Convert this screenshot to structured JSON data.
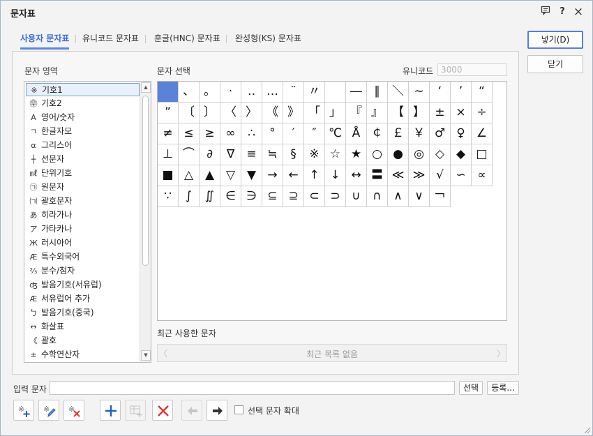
{
  "window": {
    "title": "문자표"
  },
  "titlebar": {
    "buttons": [
      "comment-icon",
      "help-icon",
      "close-icon"
    ],
    "help_glyph": "?",
    "close_glyph": "×",
    "comment_glyph": "▤"
  },
  "tabs": [
    {
      "label": "사용자 문자표",
      "active": true
    },
    {
      "label": "유니코드 문자표",
      "active": false
    },
    {
      "label": "훈글(HNC) 문자표",
      "active": false
    },
    {
      "label": "완성형(KS) 문자표",
      "active": false
    }
  ],
  "area": {
    "label": "문자 영역",
    "items": [
      {
        "icon": "※",
        "label": "기호1"
      },
      {
        "icon": "㉾",
        "label": "기호2"
      },
      {
        "icon": "A",
        "label": "영어/숫자"
      },
      {
        "icon": "ㄱ",
        "label": "한글자모"
      },
      {
        "icon": "α",
        "label": "그리스어"
      },
      {
        "icon": "┼",
        "label": "선문자"
      },
      {
        "icon": "㎖",
        "label": "단위기호"
      },
      {
        "icon": "㉠",
        "label": "원문자"
      },
      {
        "icon": "㈀",
        "label": "괄호문자"
      },
      {
        "icon": "あ",
        "label": "히라가나"
      },
      {
        "icon": "ア",
        "label": "가타카나"
      },
      {
        "icon": "Ж",
        "label": "러시아어"
      },
      {
        "icon": "Æ",
        "label": "특수외국어"
      },
      {
        "icon": "⅔",
        "label": "분수/첨자"
      },
      {
        "icon": "ʤ",
        "label": "발음기호(서유럽)"
      },
      {
        "icon": "Æ",
        "label": "서유럽어 추가"
      },
      {
        "icon": "ㄅ",
        "label": "발음기호(중국)"
      },
      {
        "icon": "↔",
        "label": "화살표"
      },
      {
        "icon": "《",
        "label": "괄호"
      },
      {
        "icon": "±",
        "label": "수학연산자"
      }
    ],
    "selected_index": 0
  },
  "chars": {
    "label": "문자 선택",
    "unicode_label": "유니코드",
    "unicode_placeholder": "3000",
    "rows": [
      [
        "　",
        "、",
        "。",
        "·",
        "‥",
        "…",
        "¨",
        "〃",
        "­",
        "―",
        "∥",
        "＼",
        "∼",
        "‘",
        "’",
        "“"
      ],
      [
        "”",
        "〔",
        "〕",
        "〈",
        "〉",
        "《",
        "》",
        "「",
        "」",
        "『",
        "』",
        "【",
        "】",
        "±",
        "×",
        "÷"
      ],
      [
        "≠",
        "≤",
        "≥",
        "∞",
        "∴",
        "°",
        "′",
        "″",
        "℃",
        "Å",
        "￠",
        "￡",
        "￥",
        "♂",
        "♀",
        "∠"
      ],
      [
        "⊥",
        "⌒",
        "∂",
        "∇",
        "≡",
        "≒",
        "§",
        "※",
        "☆",
        "★",
        "○",
        "●",
        "◎",
        "◇",
        "◆",
        "□"
      ],
      [
        "■",
        "△",
        "▲",
        "▽",
        "▼",
        "→",
        "←",
        "↑",
        "↓",
        "↔",
        "〓",
        "≪",
        "≫",
        "√",
        "∽",
        "∝"
      ],
      [
        "∵",
        "∫",
        "∬",
        "∈",
        "∋",
        "⊆",
        "⊇",
        "⊂",
        "⊃",
        "∪",
        "∩",
        "∧",
        "∨",
        "￢"
      ]
    ]
  },
  "recent": {
    "label": "최근 사용한 문자",
    "empty_text": "최근 목록 없음",
    "prev": "〈",
    "next": "〉"
  },
  "buttons": {
    "insert": "넣기(D)",
    "close": "닫기"
  },
  "input": {
    "label": "입력 문자",
    "value": "",
    "select_button": "선택",
    "register_button": "등록..."
  },
  "toolbar": {
    "tools": [
      {
        "name": "add-char-icon",
        "disabled": false
      },
      {
        "name": "edit-char-icon",
        "disabled": false
      },
      {
        "name": "delete-char-icon",
        "disabled": false
      },
      {
        "name": "add-table-icon",
        "disabled": false
      },
      {
        "name": "edit-table-icon",
        "disabled": true
      },
      {
        "name": "delete-table-icon",
        "disabled": false
      },
      {
        "name": "move-left-icon",
        "disabled": true
      },
      {
        "name": "move-right-icon",
        "disabled": false
      }
    ],
    "enlarge_label": "선택 문자 확대",
    "enlarge_checked": false
  },
  "colors": {
    "accent": "#5b82d6",
    "danger": "#d23b3b",
    "tab_active": "#3e6ec9"
  }
}
